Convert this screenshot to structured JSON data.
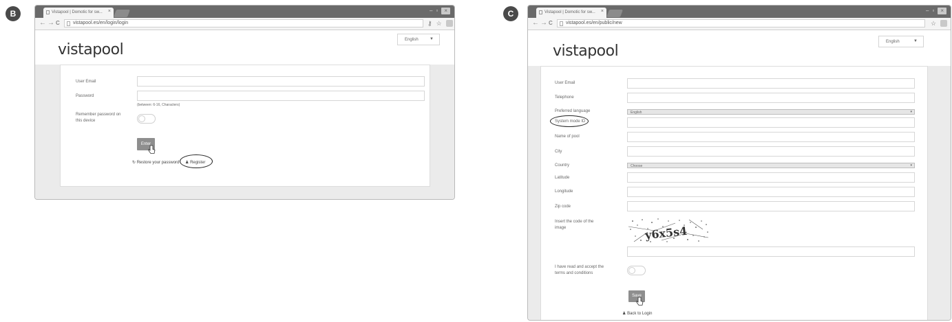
{
  "panel_b": {
    "label": "B",
    "tab_title": "Vistapool | Domotic for sw...",
    "tab_close": "×",
    "url": "vistapool.es/en/login/login",
    "nav": {
      "back": "←",
      "forward": "→",
      "reload": "C"
    },
    "toolbar_icons": {
      "key": "⚷",
      "star": "☆"
    },
    "window": {
      "minimize": "–",
      "maximize": "▫",
      "close": "×"
    },
    "logo": "vistapool",
    "language": {
      "selected": "English",
      "caret": "▼"
    },
    "form": {
      "email_label": "User Email",
      "password_label": "Password",
      "password_hint": "(between: 6-16, Characters)",
      "remember_label": "Remember password on this device",
      "enter_button": "Enter",
      "restore_link": "Restore your password",
      "register_link": "Register"
    }
  },
  "panel_c": {
    "label": "C",
    "tab_title": "Vistapool | Domotic for sw...",
    "tab_close": "×",
    "url": "vistapool.es/en/public/new",
    "nav": {
      "back": "←",
      "forward": "→",
      "reload": "C"
    },
    "toolbar_icons": {
      "star": "☆"
    },
    "window": {
      "minimize": "–",
      "maximize": "▫",
      "close": "×"
    },
    "logo": "vistapool",
    "language": {
      "selected": "English",
      "caret": "▼"
    },
    "form": {
      "email_label": "User Email",
      "telephone_label": "Telephone",
      "preferred_language_label": "Preferred language",
      "preferred_language_value": "English",
      "system_mode_label": "System mode ID",
      "pool_name_label": "Name of pool",
      "city_label": "City",
      "country_label": "Country",
      "country_value": "Choose",
      "latitude_label": "Latitude",
      "longitude_label": "Longitude",
      "zip_label": "Zip code",
      "captcha_label": "Insert the code of the image",
      "captcha_text": "y6x5s4",
      "terms_label": "I have read and accept the terms and conditions",
      "save_button": "Save",
      "back_link": "Back to Login"
    }
  },
  "colors": {
    "button_gray": "#8e8e8e",
    "tabbar": "#6a6a6a",
    "page_bg": "#ebebeb"
  }
}
